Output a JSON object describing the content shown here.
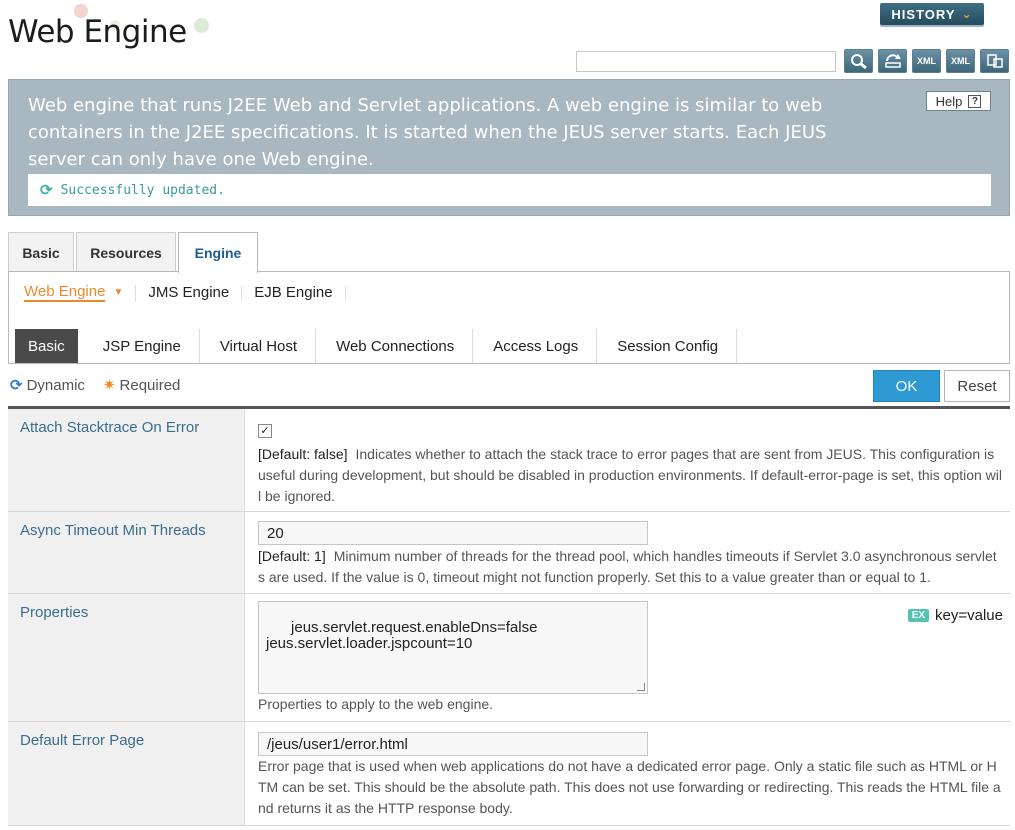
{
  "header": {
    "title": "Web Engine",
    "history_label": "HISTORY",
    "search_value": ""
  },
  "toolbar": {
    "buttons": [
      {
        "name": "search-button",
        "icon": "magnifier-icon",
        "label": ""
      },
      {
        "name": "refresh-button",
        "icon": "refresh-icon",
        "label": ""
      },
      {
        "name": "export-xml-button",
        "icon": "xml-upload-icon",
        "label": "XML"
      },
      {
        "name": "import-xml-button",
        "icon": "xml-download-icon",
        "label": "XML"
      },
      {
        "name": "batch-button",
        "icon": "batch-icon",
        "label": ""
      }
    ]
  },
  "description": {
    "text": "Web engine that runs J2EE Web and Servlet applications. A web engine is similar to web containers in the J2EE specifications. It is started when the JEUS server starts. Each JEUS server can only have one Web engine.",
    "help_label": "Help",
    "status": "Successfully updated."
  },
  "top_tabs": [
    {
      "label": "Basic",
      "active": false
    },
    {
      "label": "Resources",
      "active": false
    },
    {
      "label": "Engine",
      "active": true
    }
  ],
  "subnav": [
    {
      "label": "Web Engine",
      "active": true
    },
    {
      "label": "JMS Engine",
      "active": false
    },
    {
      "label": "EJB Engine",
      "active": false
    }
  ],
  "inner_tabs": [
    {
      "label": "Basic",
      "active": true
    },
    {
      "label": "JSP Engine",
      "active": false
    },
    {
      "label": "Virtual Host",
      "active": false
    },
    {
      "label": "Web Connections",
      "active": false
    },
    {
      "label": "Access Logs",
      "active": false
    },
    {
      "label": "Session Config",
      "active": false
    }
  ],
  "legend": {
    "dynamic": "Dynamic",
    "required": "Required"
  },
  "actions": {
    "ok": "OK",
    "reset": "Reset"
  },
  "fields": {
    "attach_stacktrace": {
      "label": "Attach Stacktrace On Error",
      "checked": true,
      "default": "[Default: false]",
      "help": "Indicates whether to attach the stack trace to error pages that are sent from JEUS. This configuration is useful during development, but should be disabled in production environments. If default-error-page is set, this option will be ignored."
    },
    "async_timeout": {
      "label": "Async Timeout Min Threads",
      "value": "20",
      "default": "[Default: 1]",
      "help": "Minimum number of threads for the thread pool, which handles timeouts if Servlet 3.0 asynchronous servlets are used. If the value is 0, timeout might not function properly. Set this to a value greater than or equal to 1."
    },
    "properties": {
      "label": "Properties",
      "value": "jeus.servlet.request.enableDns=false\njeus.servlet.loader.jspcount=10",
      "ex_badge": "EX",
      "ex_hint": "key=value",
      "help": "Properties to apply to the web engine."
    },
    "default_error_page": {
      "label": "Default Error Page",
      "value": "/jeus/user1/error.html",
      "help": "Error page that is used when web applications do not have a dedicated error page. Only a static file such as HTML or HTM can be set. This should be the absolute path. This does not use forwarding or redirecting. This reads the HTML file and returns it as the HTTP response body."
    }
  }
}
